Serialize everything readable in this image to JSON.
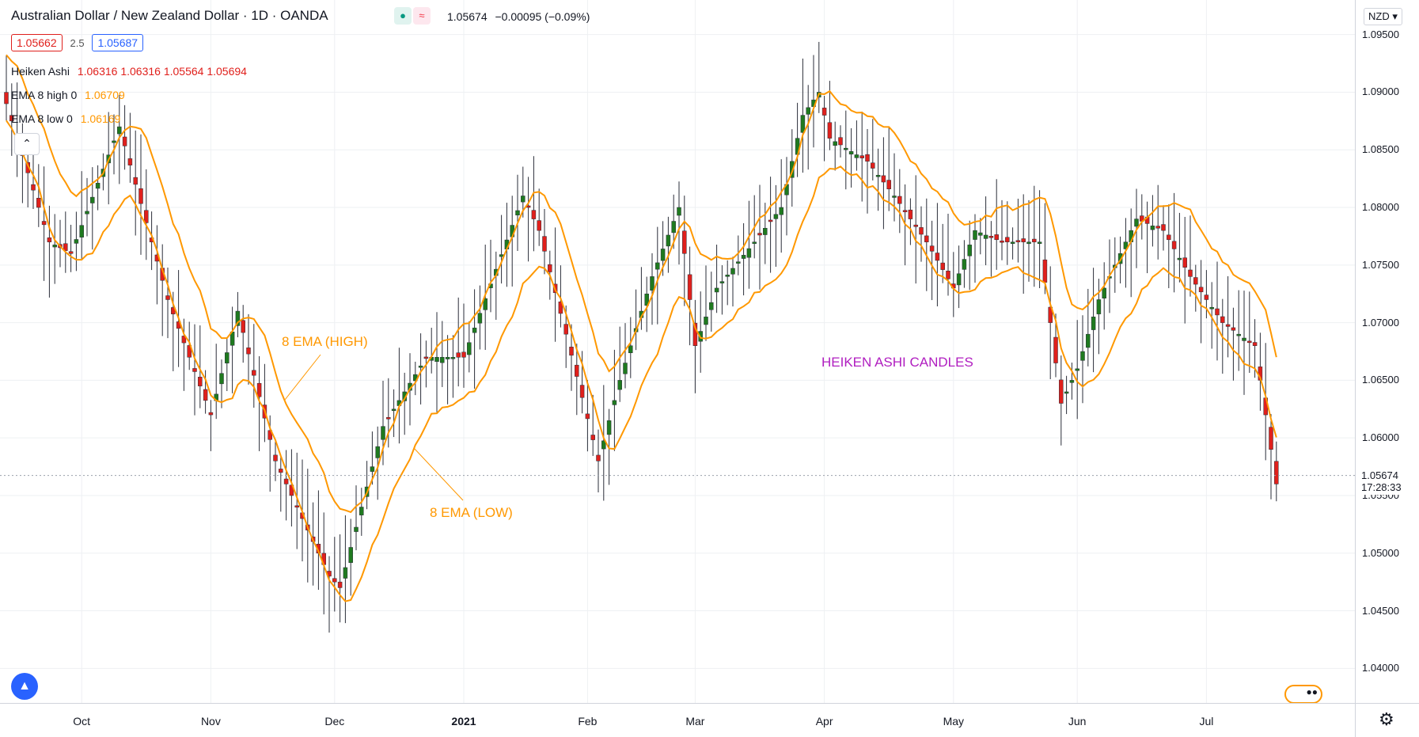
{
  "header": {
    "title": "Australian Dollar / New Zealand Dollar · 1D · OANDA",
    "last": "1.05674",
    "change": "−0.00095 (−0.09%)",
    "bid": "1.05662",
    "spread": "2.5",
    "ask": "1.05687"
  },
  "indicators": {
    "heiken_label": "Heiken Ashi",
    "heiken_values": "1.06316  1.06316  1.05564  1.05694",
    "ema_high_label": "EMA 8 high 0",
    "ema_high_value": "1.06709",
    "ema_low_label": "EMA 8 low 0",
    "ema_low_value": "1.06169"
  },
  "price_axis": {
    "currency": "NZD",
    "current_price": "1.05674",
    "countdown": "17:28:33"
  },
  "annotations": {
    "ema_high": "8 EMA (HIGH)",
    "ema_low": "8 EMA (LOW)",
    "candles": "HEIKEN ASHI CANDLES"
  },
  "colors": {
    "up": "#1f7a1f",
    "down": "#e0201c",
    "ema": "#ff9800",
    "annotation_candles": "#b01ec0",
    "grid": "#eef0f3"
  },
  "chart_data": {
    "type": "candlestick",
    "title": "Australian Dollar / New Zealand Dollar · 1D · OANDA",
    "ylim": [
      1.037,
      1.098
    ],
    "y_ticks": [
      1.04,
      1.045,
      1.05,
      1.055,
      1.06,
      1.065,
      1.07,
      1.075,
      1.08,
      1.085,
      1.09,
      1.095
    ],
    "x_ticks": [
      "Oct",
      "Nov",
      "Dec",
      "2021",
      "Feb",
      "Mar",
      "Apr",
      "May",
      "Jun",
      "Jul"
    ],
    "x_tick_index": [
      14,
      38,
      61,
      85,
      108,
      128,
      152,
      176,
      199,
      223
    ],
    "key_closes": [
      [
        0,
        1.089
      ],
      [
        8,
        1.077
      ],
      [
        12,
        1.076
      ],
      [
        21,
        1.087
      ],
      [
        30,
        1.072
      ],
      [
        38,
        1.062
      ],
      [
        43,
        1.071
      ],
      [
        50,
        1.058
      ],
      [
        60,
        1.048
      ],
      [
        62,
        1.047
      ],
      [
        70,
        1.061
      ],
      [
        78,
        1.067
      ],
      [
        85,
        1.067
      ],
      [
        96,
        1.081
      ],
      [
        99,
        1.078
      ],
      [
        104,
        1.069
      ],
      [
        110,
        1.058
      ],
      [
        114,
        1.065
      ],
      [
        120,
        1.074
      ],
      [
        125,
        1.08
      ],
      [
        128,
        1.068
      ],
      [
        132,
        1.073
      ],
      [
        139,
        1.077
      ],
      [
        144,
        1.08
      ],
      [
        148,
        1.088
      ],
      [
        151,
        1.09
      ],
      [
        153,
        1.086
      ],
      [
        160,
        1.084
      ],
      [
        165,
        1.081
      ],
      [
        171,
        1.077
      ],
      [
        176,
        1.073
      ],
      [
        180,
        1.078
      ],
      [
        185,
        1.077
      ],
      [
        192,
        1.077
      ],
      [
        196,
        1.063
      ],
      [
        199,
        1.066
      ],
      [
        203,
        1.072
      ],
      [
        210,
        1.079
      ],
      [
        215,
        1.078
      ],
      [
        220,
        1.074
      ],
      [
        226,
        1.07
      ],
      [
        232,
        1.068
      ],
      [
        234,
        1.062
      ],
      [
        236,
        1.056
      ]
    ],
    "ema_high_last": 1.06709,
    "ema_low_last": 1.06169
  }
}
